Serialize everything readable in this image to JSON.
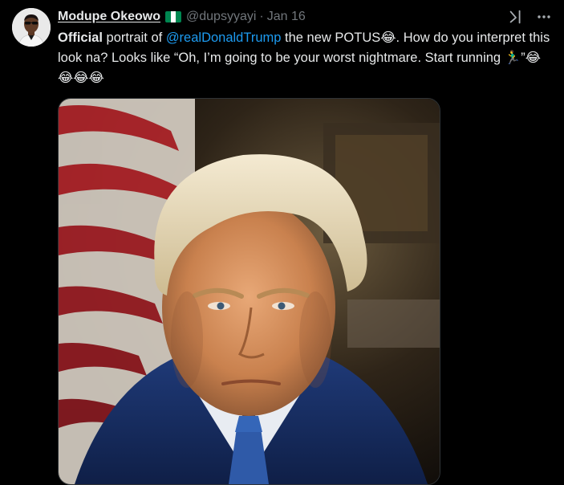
{
  "author": {
    "display_name": "Modupe Okeowo",
    "handle": "@dupsyyayi",
    "separator": "·",
    "date": "Jan 16"
  },
  "tweet": {
    "part1": "Official",
    "part2": " portrait of ",
    "mention": "@realDonaldTrump",
    "part3": " the new POTUS",
    "emoji1": "😂",
    "part4": ". How do you interpret this look na? Looks like “Oh, I’m going to be your worst nightmare. Start running ",
    "emoji2": "🏃‍♂️",
    "part5": "”",
    "emoji3": "😂😂😂😂"
  },
  "colors": {
    "background": "#000000",
    "text": "#e7e9ea",
    "secondary": "#71767b",
    "link": "#1d9bf0",
    "flag_green": "#008751",
    "flag_white": "#ffffff"
  },
  "icons": {
    "verified_flag": "nigeria-flag-icon",
    "grok": "grok-icon",
    "more": "more-icon"
  }
}
